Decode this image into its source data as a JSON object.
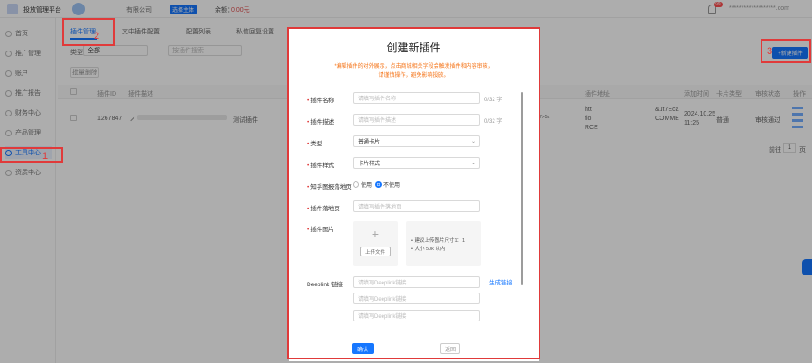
{
  "app": {
    "title": "投放管理平台",
    "company": "有限公司",
    "badge": "选择主体",
    "balance_label": "余额：",
    "balance_value": "0.00元",
    "notif_count": "99",
    "user": "*******************.com"
  },
  "sidebar": {
    "items": [
      {
        "label": "首页"
      },
      {
        "label": "推广管理"
      },
      {
        "label": "账户"
      },
      {
        "label": "推广报告"
      },
      {
        "label": "财务中心"
      },
      {
        "label": "产品管理"
      },
      {
        "label": "工具中心"
      },
      {
        "label": "资质中心"
      }
    ],
    "selected_index": 6
  },
  "tabs": [
    {
      "label": "插件管理",
      "active": true
    },
    {
      "label": "文中插件配置"
    },
    {
      "label": "配置列表"
    },
    {
      "label": "私信回复设置"
    }
  ],
  "filters": {
    "type_label": "类型",
    "type_value": "全部",
    "search_placeholder": "按插件搜索"
  },
  "batch_button": "批量删除",
  "new_button": "+新建插件",
  "table": {
    "headers": [
      "插件ID",
      "插件描述",
      "",
      "插件地址",
      "添加时间",
      "卡片类型",
      "审核状态",
      "操作"
    ],
    "row": {
      "id": "1267847",
      "desc": "测试插件",
      "url_lines": [
        "htt",
        "flo",
        "RCE"
      ],
      "url_tail": [
        "&ut7Eca",
        "COMME"
      ],
      "mid": "7>5a",
      "added": [
        "2024.10.25",
        "11:25"
      ],
      "card": "普通",
      "status": "审核通过"
    }
  },
  "pagination": {
    "goto_label": "前往",
    "page": "1",
    "page_suffix": "页"
  },
  "annotations": {
    "one": "1",
    "two": "2",
    "three": "3"
  },
  "modal": {
    "title": "创建新插件",
    "notice_line1": "*编辑插件的对外展示，点击商城相关字段会触发插件和内容审核，",
    "notice_line2": "请谨慎操作，避免影响投放。",
    "name_label": "插件名称",
    "name_placeholder": "请填写插件名称",
    "name_count": "0/32 字",
    "desc_label": "插件描述",
    "desc_placeholder": "请填写插件描述",
    "desc_count": "0/32 字",
    "type_label": "类型",
    "type_value": "普通卡片",
    "style_label": "插件样式",
    "style_value": "卡片样式",
    "landing_switch_label": "知乎图报落地页",
    "opt_use": "使用",
    "opt_nouse": "不使用",
    "landing_label": "插件落地页",
    "landing_placeholder": "请填写插件落地页",
    "image_label": "插件图片",
    "upload_plus": "+",
    "upload_button": "上传文件",
    "image_hint1": "• 建议上传图片尺寸1：1",
    "image_hint2": "• 大小 50k 以内",
    "deeplink_label": "Deeplink 链接",
    "deeplink_placeholder": "请填写Deeplink链接",
    "generate_link": "生成链接",
    "confirm": "确认",
    "back": "返回"
  },
  "colors": {
    "accent": "#1677ff",
    "annotation": "#e03a3a",
    "notice": "#f5751a"
  }
}
